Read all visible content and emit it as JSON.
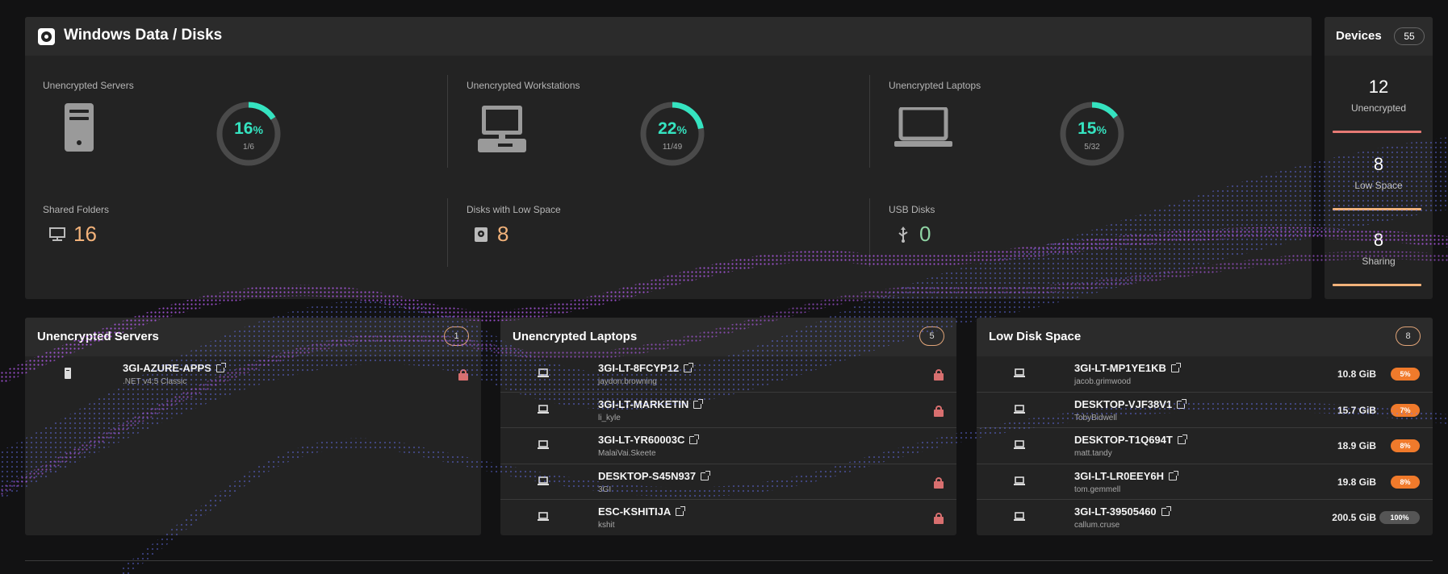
{
  "header": {
    "title": "Windows Data / Disks",
    "icon": "disk-app-icon"
  },
  "stats": {
    "unencrypted_servers": {
      "label": "Unencrypted Servers",
      "icon": "server-icon",
      "percent_value": "16",
      "percent_unit": "%",
      "fraction": "1/6",
      "ratio": 0.16
    },
    "unencrypted_workstations": {
      "label": "Unencrypted Workstations",
      "icon": "workstation-icon",
      "percent_value": "22",
      "percent_unit": "%",
      "fraction": "11/49",
      "ratio": 0.22
    },
    "unencrypted_laptops": {
      "label": "Unencrypted Laptops",
      "icon": "laptop-icon",
      "percent_value": "15",
      "percent_unit": "%",
      "fraction": "5/32",
      "ratio": 0.15
    },
    "shared_folders": {
      "label": "Shared Folders",
      "icon": "shared-folder-icon",
      "value": "16",
      "color": "#f2b27a"
    },
    "low_space_disks": {
      "label": "Disks with Low Space",
      "icon": "disk-icon",
      "value": "8",
      "color": "#f2b27a"
    },
    "usb_disks": {
      "label": "USB Disks",
      "icon": "usb-icon",
      "value": "0",
      "color": "#8fd4a4"
    }
  },
  "devices": {
    "title": "Devices",
    "count": "55",
    "items": [
      {
        "value": "12",
        "label": "Unencrypted",
        "color": "#e67a74"
      },
      {
        "value": "8",
        "label": "Low Space",
        "color": "#f2b27a"
      },
      {
        "value": "8",
        "label": "Sharing",
        "color": "#f2b27a"
      }
    ]
  },
  "panels": {
    "servers": {
      "title": "Unencrypted Servers",
      "count": "1",
      "rows": [
        {
          "name": "3GI-AZURE-APPS",
          "sub": ".NET v4.5 Classic",
          "locked": true
        }
      ]
    },
    "laptops": {
      "title": "Unencrypted Laptops",
      "count": "5",
      "rows": [
        {
          "name": "3GI-LT-8FCYP12",
          "sub": "jaydon.browning",
          "locked": true
        },
        {
          "name": "3GI-LT-MARKETIN",
          "sub": "li_kyle",
          "locked": true
        },
        {
          "name": "3GI-LT-YR60003C",
          "sub": "MalaiVai.Skeete",
          "locked": false
        },
        {
          "name": "DESKTOP-S45N937",
          "sub": "3GI",
          "locked": true
        },
        {
          "name": "ESC-KSHITIJA",
          "sub": "kshit",
          "locked": true
        }
      ]
    },
    "low_disk": {
      "title": "Low Disk Space",
      "count": "8",
      "rows": [
        {
          "name": "3GI-LT-MP1YE1KB",
          "sub": "jacob.grimwood",
          "size": "10.8 GiB",
          "percent": "5%",
          "badge_color": "#f07a2b"
        },
        {
          "name": "DESKTOP-VJF38V1",
          "sub": "TobyBidwell",
          "size": "15.7 GiB",
          "percent": "7%",
          "badge_color": "#f07a2b"
        },
        {
          "name": "DESKTOP-T1Q694T",
          "sub": "matt.tandy",
          "size": "18.9 GiB",
          "percent": "8%",
          "badge_color": "#f07a2b"
        },
        {
          "name": "3GI-LT-LR0EEY6H",
          "sub": "tom.gemmell",
          "size": "19.8 GiB",
          "percent": "8%",
          "badge_color": "#f07a2b"
        },
        {
          "name": "3GI-LT-39505460",
          "sub": "callum.cruse",
          "size": "200.5 GiB",
          "percent": "100%",
          "badge_color": "#555555"
        }
      ]
    }
  },
  "colors": {
    "gauge_fill": "#35e3c0",
    "gauge_track": "#4a4a4a",
    "lock": "#d86f6f"
  }
}
